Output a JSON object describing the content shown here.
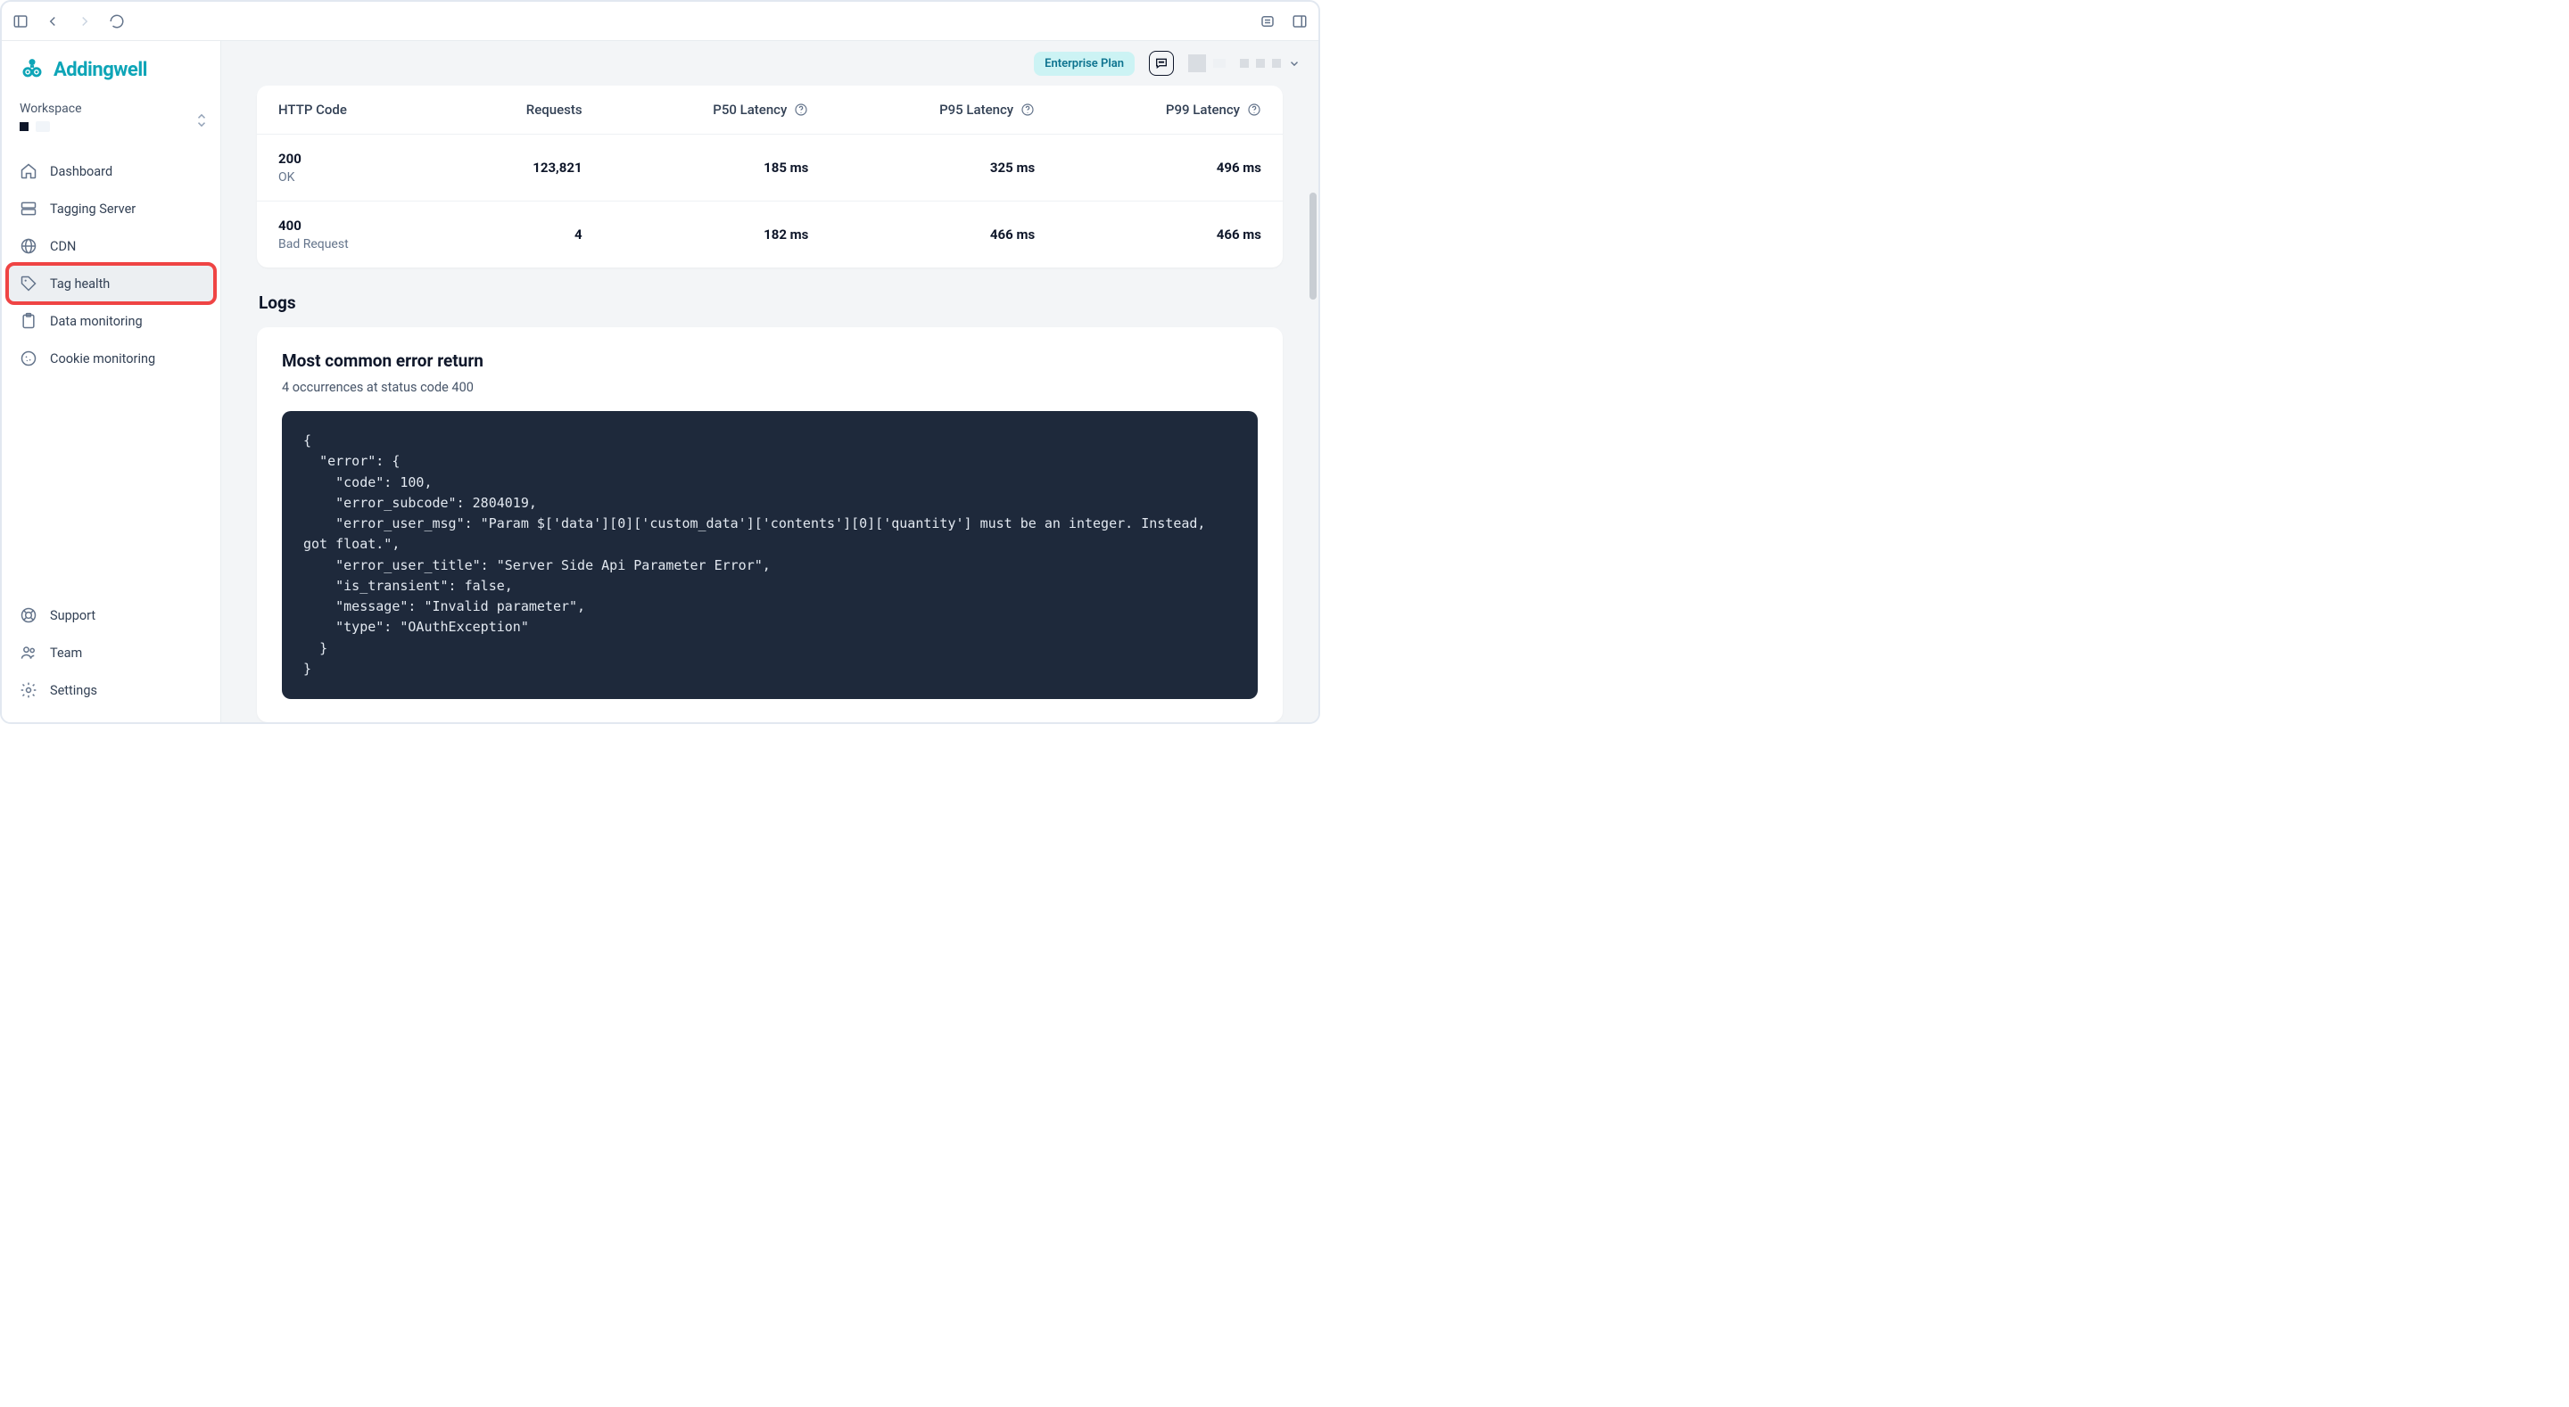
{
  "brand": "Addingwell",
  "workspace_label": "Workspace",
  "nav": {
    "dashboard": "Dashboard",
    "tagging_server": "Tagging Server",
    "cdn": "CDN",
    "tag_health": "Tag health",
    "data_monitoring": "Data monitoring",
    "cookie_monitoring": "Cookie monitoring"
  },
  "nav_bottom": {
    "support": "Support",
    "team": "Team",
    "settings": "Settings"
  },
  "topbar": {
    "plan_badge": "Enterprise Plan"
  },
  "table": {
    "headers": {
      "http_code": "HTTP Code",
      "requests": "Requests",
      "p50": "P50 Latency",
      "p95": "P95 Latency",
      "p99": "P99 Latency"
    },
    "rows": [
      {
        "code": "200",
        "label": "OK",
        "requests": "123,821",
        "p50": "185 ms",
        "p95": "325 ms",
        "p99": "496 ms"
      },
      {
        "code": "400",
        "label": "Bad Request",
        "requests": "4",
        "p50": "182 ms",
        "p95": "466 ms",
        "p99": "466 ms"
      }
    ]
  },
  "logs": {
    "section_title": "Logs",
    "heading": "Most common error return",
    "subtitle": "4 occurrences at status code 400",
    "code": "{\n  \"error\": {\n    \"code\": 100,\n    \"error_subcode\": 2804019,\n    \"error_user_msg\": \"Param $['data'][0]['custom_data']['contents'][0]['quantity'] must be an integer. Instead, got float.\",\n    \"error_user_title\": \"Server Side Api Parameter Error\",\n    \"is_transient\": false,\n    \"message\": \"Invalid parameter\",\n    \"type\": \"OAuthException\"\n  }\n}"
  }
}
